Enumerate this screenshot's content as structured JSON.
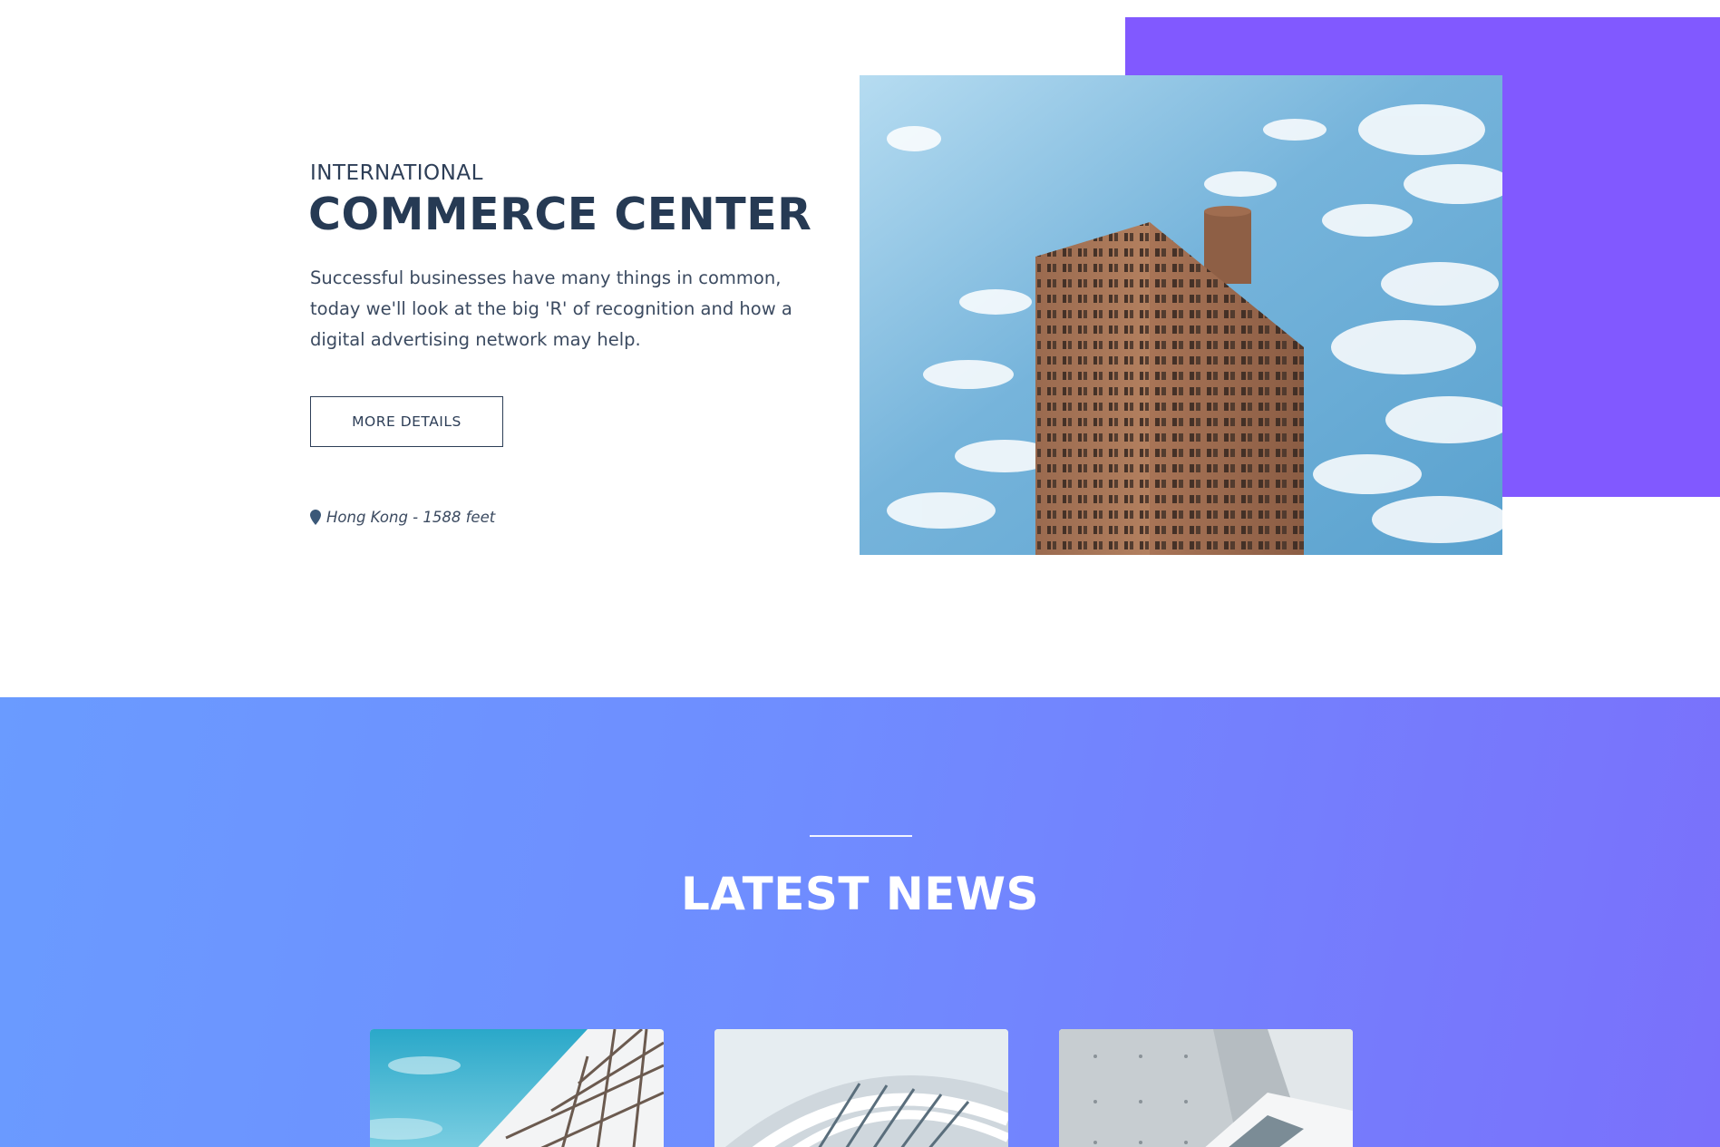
{
  "hero": {
    "kicker": "INTERNATIONAL",
    "title": "COMMERCE CENTER",
    "description": "Successful businesses have many things in common, today we'll look at the big 'R' of recognition and how a digital advertising network may help.",
    "button_label": "MORE DETAILS",
    "location": "Hong Kong - 1588 feet",
    "icons": {
      "location": "map-pin-icon"
    }
  },
  "news": {
    "title": "LATEST NEWS"
  },
  "colors": {
    "accent_purple": "#8159ff",
    "heading_navy": "#263a54",
    "gradient_start": "#6a9bff",
    "gradient_end": "#7a70fb"
  }
}
